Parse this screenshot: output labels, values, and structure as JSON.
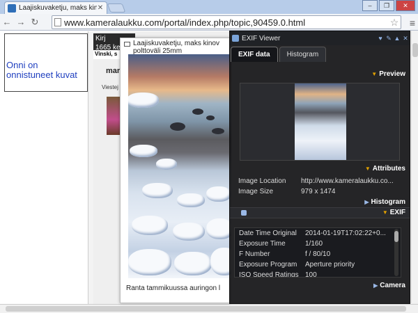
{
  "browser": {
    "tab_title": "Laajiskuvaketju, maks kinova",
    "url": "www.kameralaukku.com/portal/index.php/topic,90459.0.html"
  },
  "page": {
    "banner_text": "Onni on onnistuneet kuvat",
    "forum_header_line1": "Kirj",
    "forum_header_line2": "1665 ke",
    "forum_row": "Vinski, s",
    "forum_name": "mar",
    "forum_sub": "Viestej"
  },
  "lightbox": {
    "title": "Laajiskuvaketju, maks kinov polttoväli 25mm",
    "caption": "Ranta tammikuussa auringon l"
  },
  "exif_viewer": {
    "title": "EXIF Viewer",
    "tabs": [
      {
        "label": "EXIF data",
        "active": true
      },
      {
        "label": "Histogram",
        "active": false
      }
    ],
    "sections": {
      "preview": "Preview",
      "attributes": "Attributes",
      "histogram": "Histogram",
      "exif": "EXIF",
      "camera": "Camera"
    },
    "attributes": [
      {
        "key": "Image Location",
        "value": "http://www.kameralaukku.co..."
      },
      {
        "key": "Image Size",
        "value": "979 x 1474"
      }
    ],
    "exif_rows": [
      {
        "key": "Date Time Original",
        "value": "2014-01-19T17:02:22+0..."
      },
      {
        "key": "Exposure Time",
        "value": "1/160"
      },
      {
        "key": "F Number",
        "value": "f / 80/10"
      },
      {
        "key": "Exposure Program",
        "value": "Aperture priority"
      },
      {
        "key": "ISO Speed Ratings",
        "value": "100"
      }
    ]
  }
}
